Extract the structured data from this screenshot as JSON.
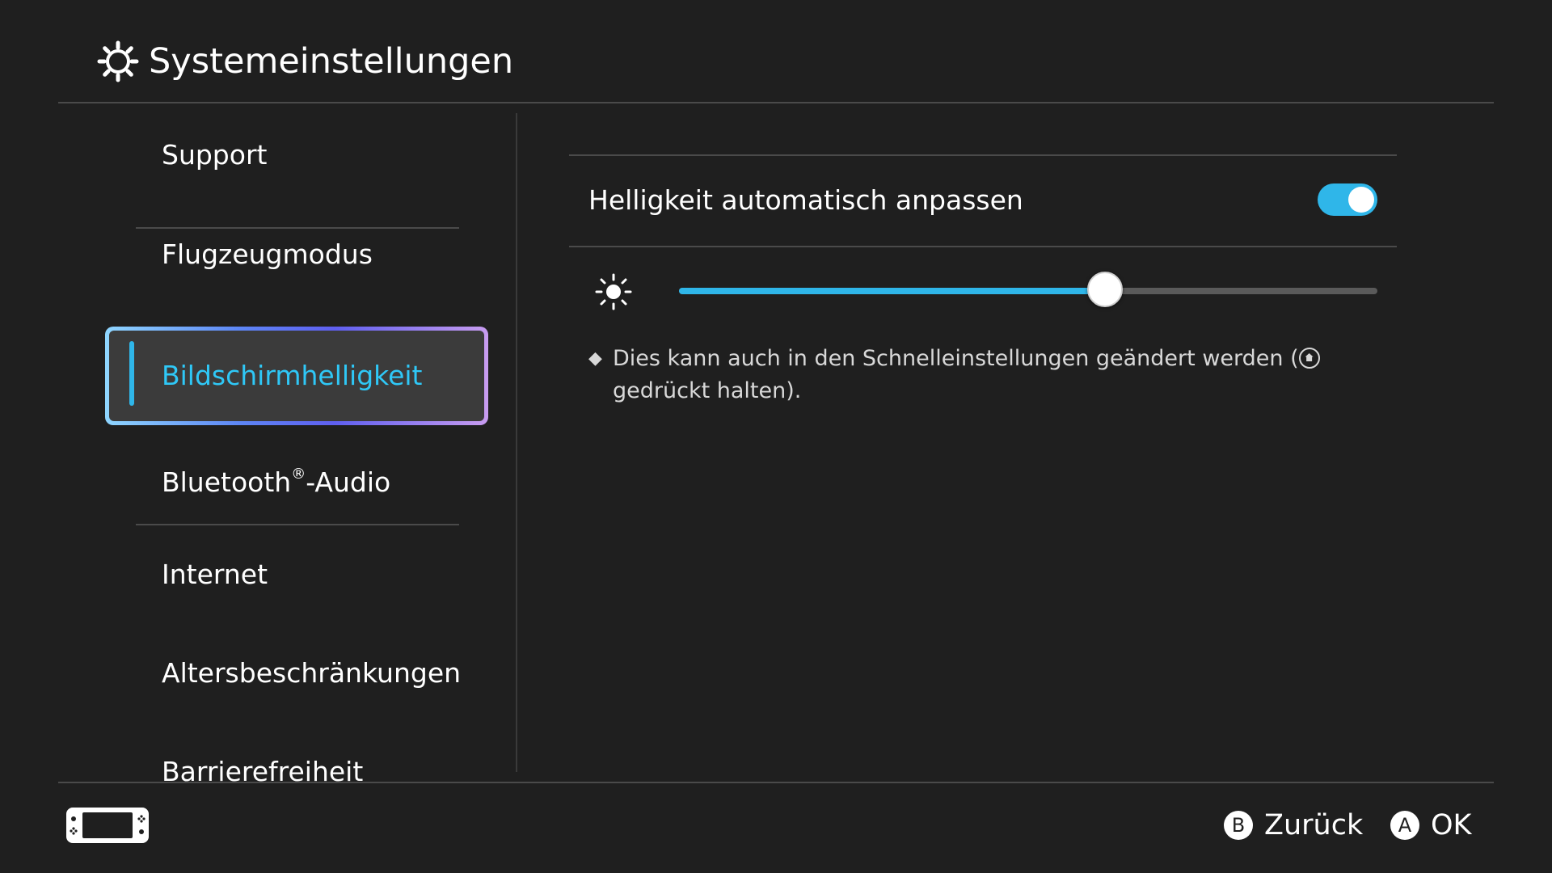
{
  "header": {
    "title": "Systemeinstellungen",
    "icon": "gear-icon"
  },
  "sidebar": {
    "items": [
      {
        "label": "Support",
        "selected": false
      },
      {
        "label": "Flugzeugmodus",
        "selected": false
      },
      {
        "label": "Bildschirmhelligkeit",
        "selected": true
      },
      {
        "label_main": "Bluetooth",
        "label_sup": "®",
        "label_suffix": "-Audio",
        "selected": false
      },
      {
        "label": "Internet",
        "selected": false
      },
      {
        "label": "Altersbeschränkungen",
        "selected": false
      },
      {
        "label": "Barrierefreiheit",
        "selected": false
      }
    ]
  },
  "main": {
    "auto_brightness": {
      "label": "Helligkeit automatisch anpassen",
      "enabled": true
    },
    "brightness_slider": {
      "icon": "sun-icon",
      "value_fraction": 0.61
    },
    "note": {
      "bullet": "◆",
      "text_before": "Dies kann auch in den Schnelleinstellungen geändert werden (",
      "icon": "home-button-icon",
      "text_after": " gedrückt halten)."
    }
  },
  "footer": {
    "console_icon": "handheld-console-icon",
    "back": {
      "button": "B",
      "label": "Zurück"
    },
    "ok": {
      "button": "A",
      "label": "OK"
    }
  },
  "colors": {
    "background": "#1f1f1f",
    "accent": "#2fb6e9",
    "selected_text": "#2fc8f7",
    "divider": "#4a4a4a"
  }
}
